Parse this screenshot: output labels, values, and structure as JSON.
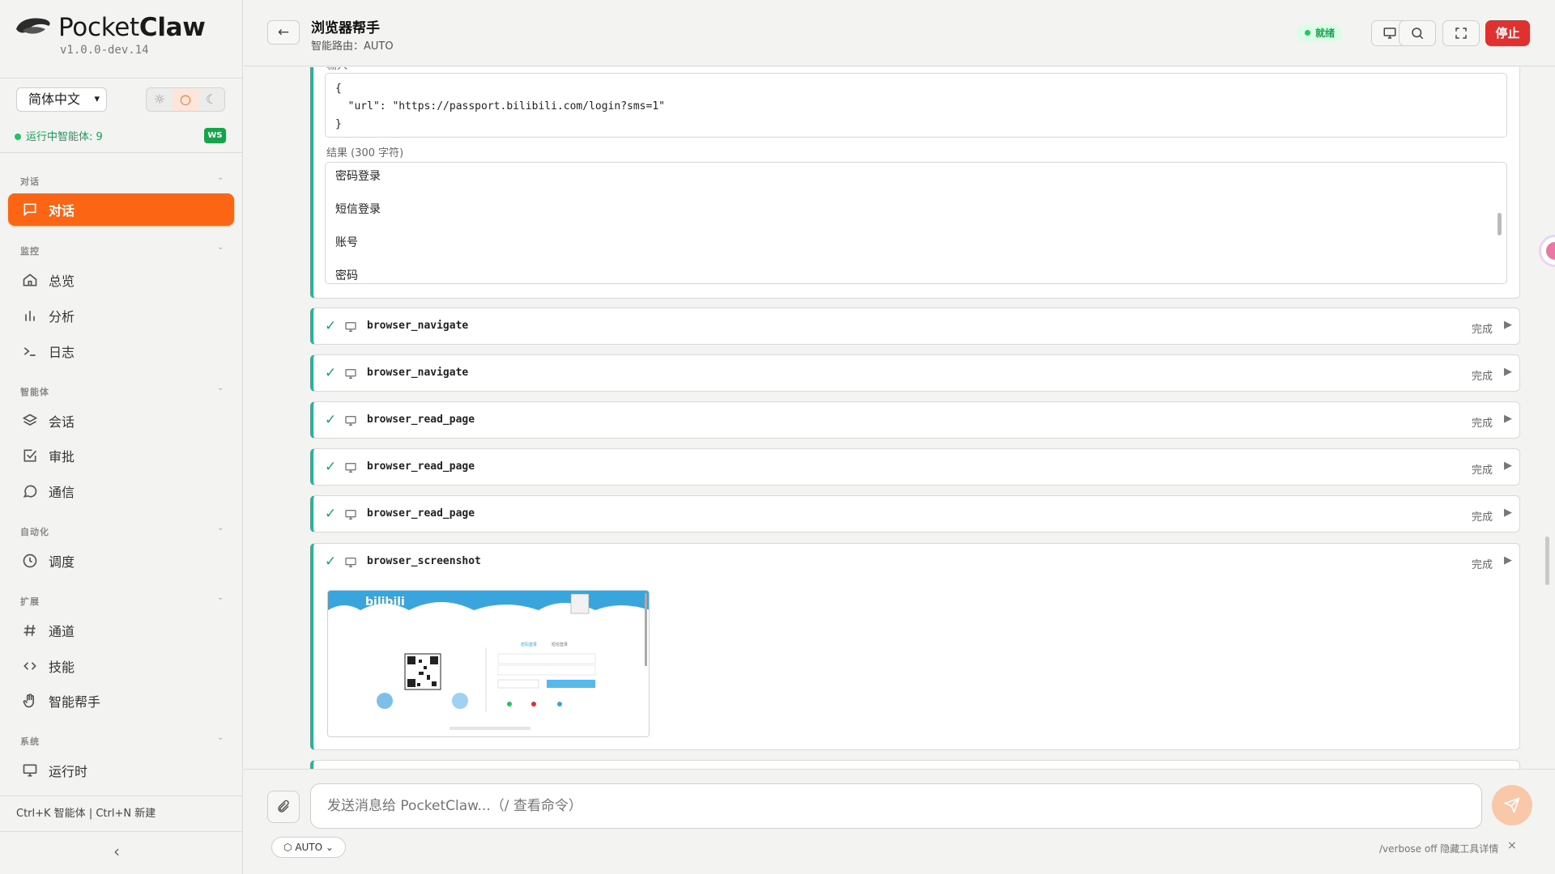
{
  "app": {
    "brand_light": "Pocket",
    "brand_bold": "Claw",
    "version": "v1.0.0-dev.14"
  },
  "sidebar": {
    "language": "简体中文",
    "theme": [
      "☼",
      "○",
      "☾"
    ],
    "running_label": "运行中智能体: 9",
    "ws_badge": "WS",
    "sections": [
      {
        "title": "对话",
        "items": [
          {
            "label": "对话",
            "icon": "chat-bubble-icon",
            "active": true
          }
        ]
      },
      {
        "title": "监控",
        "items": [
          {
            "label": "总览",
            "icon": "home-icon"
          },
          {
            "label": "分析",
            "icon": "bar-chart-icon"
          },
          {
            "label": "日志",
            "icon": "terminal-icon"
          }
        ]
      },
      {
        "title": "智能体",
        "items": [
          {
            "label": "会话",
            "icon": "layers-icon"
          },
          {
            "label": "审批",
            "icon": "checkbox-icon"
          },
          {
            "label": "通信",
            "icon": "message-circle-icon"
          }
        ]
      },
      {
        "title": "自动化",
        "items": [
          {
            "label": "调度",
            "icon": "clock-icon"
          }
        ]
      },
      {
        "title": "扩展",
        "items": [
          {
            "label": "通道",
            "icon": "hash-icon"
          },
          {
            "label": "技能",
            "icon": "code-icon"
          },
          {
            "label": "智能帮手",
            "icon": "hand-icon"
          }
        ]
      },
      {
        "title": "系统",
        "items": [
          {
            "label": "运行时",
            "icon": "monitor-icon"
          }
        ]
      }
    ],
    "shortcuts": "Ctrl+K 智能体 | Ctrl+N 新建",
    "collapse_glyph": "‹"
  },
  "header": {
    "title": "浏览器帮手",
    "subtitle": "智能路由：AUTO",
    "status": "就绪",
    "stop_label": "停止"
  },
  "conversation": {
    "input_label": "输入",
    "input_code": "{\n  \"url\": \"https://passport.bilibili.com/login?sms=1\"\n}",
    "result_label": "结果 (300 字符)",
    "result_lines": [
      "密码登录",
      "短信登录",
      "账号",
      "密码"
    ],
    "tool_calls": [
      {
        "name": "browser_navigate",
        "status": "完成"
      },
      {
        "name": "browser_navigate",
        "status": "完成"
      },
      {
        "name": "browser_read_page",
        "status": "完成"
      },
      {
        "name": "browser_read_page",
        "status": "完成"
      },
      {
        "name": "browser_read_page",
        "status": "完成"
      },
      {
        "name": "browser_screenshot",
        "status": "完成"
      }
    ],
    "screenshot": {
      "logo_text": "bilibili",
      "tab_password": "密码登录",
      "tab_sms": "短信登录"
    }
  },
  "composer": {
    "placeholder": "发送消息给 PocketClaw...（/ 查看命令）",
    "mode": "AUTO",
    "verbose_hint": "/verbose off 隐藏工具详情",
    "close_glyph": "×"
  },
  "colors": {
    "accent": "#fb6514",
    "teal": "#27b3a1",
    "danger": "#e03131",
    "success": "#22c55e"
  }
}
